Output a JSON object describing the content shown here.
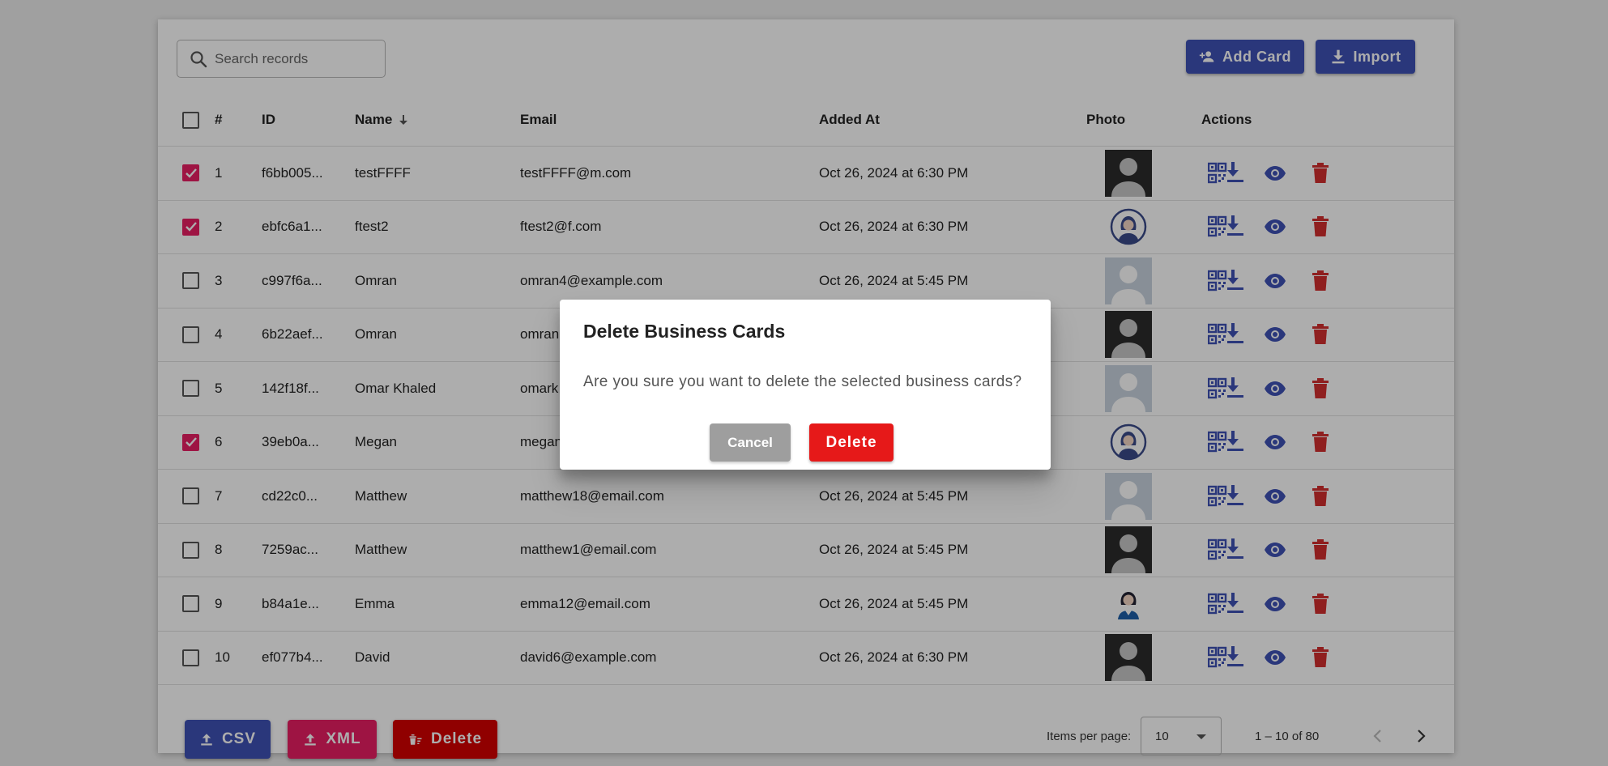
{
  "search": {
    "placeholder": "Search records"
  },
  "toolbar": {
    "add_label": "Add Card",
    "import_label": "Import"
  },
  "table": {
    "headers": {
      "num": "#",
      "id": "ID",
      "name": "Name",
      "email": "Email",
      "added_at": "Added At",
      "photo": "Photo",
      "actions": "Actions"
    },
    "rows": [
      {
        "num": "1",
        "id": "f6bb005...",
        "name": "testFFFF",
        "email": "testFFFF@m.com",
        "added_at": "Oct 26, 2024 at 6:30 PM",
        "checked": true,
        "photo": "dark"
      },
      {
        "num": "2",
        "id": "ebfc6a1...",
        "name": "ftest2",
        "email": "ftest2@f.com",
        "added_at": "Oct 26, 2024 at 6:30 PM",
        "checked": true,
        "photo": "female-outline"
      },
      {
        "num": "3",
        "id": "c997f6a...",
        "name": "Omran",
        "email": "omran4@example.com",
        "added_at": "Oct 26, 2024 at 5:45 PM",
        "checked": false,
        "photo": "light"
      },
      {
        "num": "4",
        "id": "6b22aef...",
        "name": "Omran",
        "email": "omran",
        "added_at": "",
        "checked": false,
        "photo": "dark"
      },
      {
        "num": "5",
        "id": "142f18f...",
        "name": "Omar Khaled",
        "email": "omark",
        "added_at": "",
        "checked": false,
        "photo": "light"
      },
      {
        "num": "6",
        "id": "39eb0a...",
        "name": "Megan",
        "email": "megan",
        "added_at": "",
        "checked": true,
        "photo": "female-outline"
      },
      {
        "num": "7",
        "id": "cd22c0...",
        "name": "Matthew",
        "email": "matthew18@email.com",
        "added_at": "Oct 26, 2024 at 5:45 PM",
        "checked": false,
        "photo": "light"
      },
      {
        "num": "8",
        "id": "7259ac...",
        "name": "Matthew",
        "email": "matthew1@email.com",
        "added_at": "Oct 26, 2024 at 5:45 PM",
        "checked": false,
        "photo": "dark"
      },
      {
        "num": "9",
        "id": "b84a1e...",
        "name": "Emma",
        "email": "emma12@email.com",
        "added_at": "Oct 26, 2024 at 5:45 PM",
        "checked": false,
        "photo": "female-small"
      },
      {
        "num": "10",
        "id": "ef077b4...",
        "name": "David",
        "email": "david6@example.com",
        "added_at": "Oct 26, 2024 at 6:30 PM",
        "checked": false,
        "photo": "dark"
      }
    ]
  },
  "footer": {
    "csv_label": "CSV",
    "xml_label": "XML",
    "delete_label": "Delete",
    "items_per_page_label": "Items per page:",
    "items_per_page_value": "10",
    "range_label": "1 – 10 of 80"
  },
  "dialog": {
    "title": "Delete Business Cards",
    "message": "Are you sure you want to delete the selected business cards?",
    "cancel_label": "Cancel",
    "delete_label": "Delete"
  },
  "colors": {
    "primary": "#3f51b5",
    "accent": "#e91e63",
    "danger": "#d50000",
    "dialog_delete": "#e61919",
    "cancel": "#9e9e9e"
  },
  "icons": {
    "search": "search-icon",
    "add": "person-add-icon",
    "import": "download-icon",
    "qr": "qr-download-icon",
    "view": "eye-icon",
    "delete": "trash-icon"
  }
}
